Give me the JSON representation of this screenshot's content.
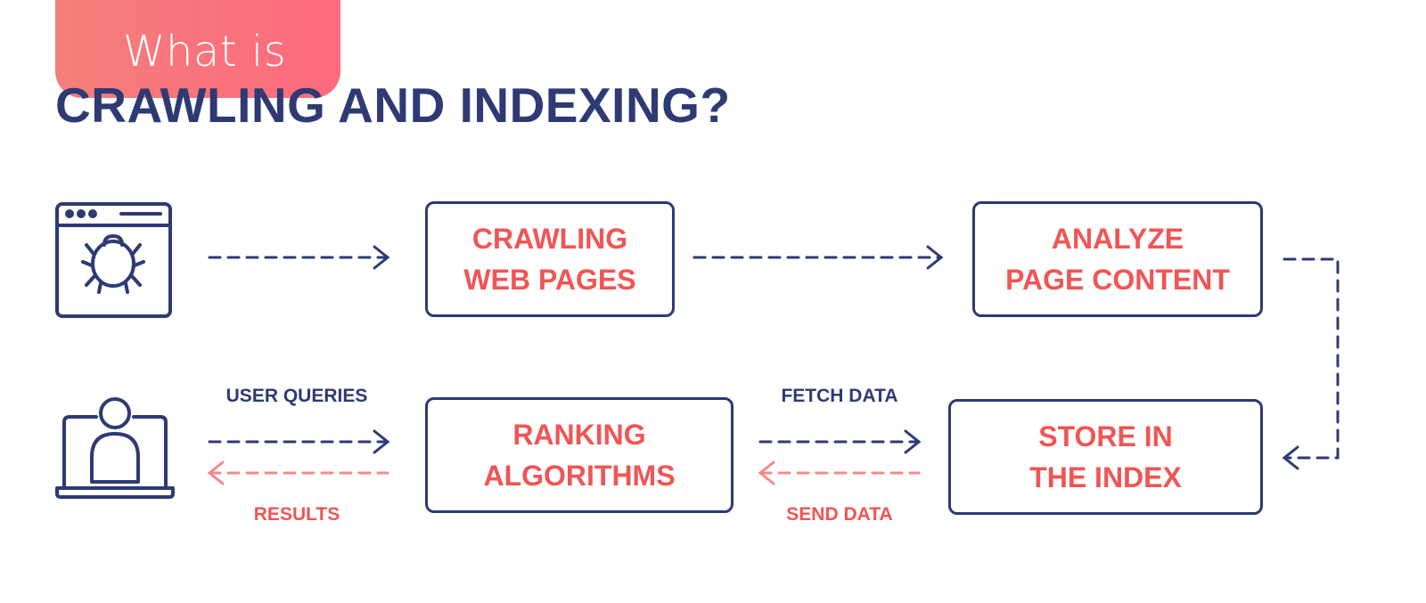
{
  "header": {
    "tag_text": "What is",
    "title": "CRAWLING AND INDEXING?"
  },
  "colors": {
    "navy": "#2d3a74",
    "coral": "#f05555",
    "coral_light": "#f48a8a",
    "tag_gradient_start": "#f37f7a",
    "tag_gradient_end": "#fe6a7e"
  },
  "icons": {
    "crawler": "browser-bug-icon",
    "user": "laptop-user-icon"
  },
  "nodes": {
    "crawling": {
      "line1": "CRAWLING",
      "line2": "WEB PAGES"
    },
    "analyze": {
      "line1": "ANALYZE",
      "line2": "PAGE CONTENT"
    },
    "store": {
      "line1": "STORE IN",
      "line2": "THE INDEX"
    },
    "ranking": {
      "line1": "RANKING",
      "line2": "ALGORITHMS"
    }
  },
  "edge_labels": {
    "user_queries": "USER QUERIES",
    "results": "RESULTS",
    "fetch_data": "FETCH DATA",
    "send_data": "SEND DATA"
  },
  "edges": [
    {
      "from": "crawler",
      "to": "crawling",
      "style": "dashed",
      "color": "navy"
    },
    {
      "from": "crawling",
      "to": "analyze",
      "style": "dashed",
      "color": "navy"
    },
    {
      "from": "analyze",
      "to": "store",
      "style": "dashed",
      "color": "navy"
    },
    {
      "from": "user",
      "to": "ranking",
      "label": "USER QUERIES",
      "style": "dashed",
      "color": "navy"
    },
    {
      "from": "ranking",
      "to": "user",
      "label": "RESULTS",
      "style": "dashed",
      "color": "coral"
    },
    {
      "from": "ranking",
      "to": "store",
      "label": "FETCH DATA",
      "style": "dashed",
      "color": "navy"
    },
    {
      "from": "store",
      "to": "ranking",
      "label": "SEND DATA",
      "style": "dashed",
      "color": "coral"
    }
  ]
}
